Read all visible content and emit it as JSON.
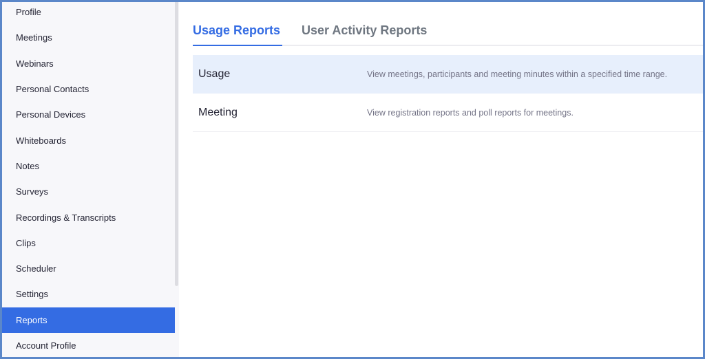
{
  "sidebar": {
    "items": [
      {
        "label": "Profile",
        "active": false
      },
      {
        "label": "Meetings",
        "active": false
      },
      {
        "label": "Webinars",
        "active": false
      },
      {
        "label": "Personal Contacts",
        "active": false
      },
      {
        "label": "Personal Devices",
        "active": false
      },
      {
        "label": "Whiteboards",
        "active": false
      },
      {
        "label": "Notes",
        "active": false
      },
      {
        "label": "Surveys",
        "active": false
      },
      {
        "label": "Recordings & Transcripts",
        "active": false
      },
      {
        "label": "Clips",
        "active": false
      },
      {
        "label": "Scheduler",
        "active": false
      },
      {
        "label": "Settings",
        "active": false
      },
      {
        "label": "Reports",
        "active": true
      },
      {
        "label": "Account Profile",
        "active": false
      }
    ]
  },
  "main": {
    "tabs": [
      {
        "label": "Usage Reports",
        "active": true
      },
      {
        "label": "User Activity Reports",
        "active": false
      }
    ],
    "reports": [
      {
        "name": "Usage",
        "description": "View meetings, participants and meeting minutes within a specified time range.",
        "highlighted": true
      },
      {
        "name": "Meeting",
        "description": "View registration reports and poll reports for meetings.",
        "highlighted": false
      }
    ]
  },
  "colors": {
    "accent": "#346ce3",
    "frame_border": "#5b87c9",
    "row_highlight": "#e7effc",
    "sidebar_bg": "#f7f7fa"
  }
}
